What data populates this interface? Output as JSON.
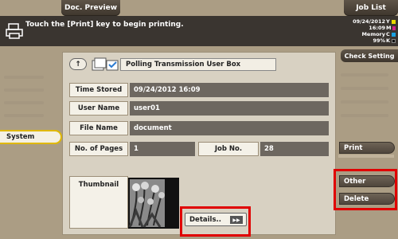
{
  "header": {
    "doc_preview_tab": "Doc. Preview",
    "job_list_tab": "Job List"
  },
  "message_bar": {
    "text": "Touch the [Print] key to begin printing.",
    "date": "09/24/2012",
    "time": "16:09",
    "memory_label": "Memory",
    "memory_value": "99%",
    "toner": [
      {
        "letter": "Y",
        "color": "#e8d800"
      },
      {
        "letter": "M",
        "color": "#d0208a"
      },
      {
        "letter": "C",
        "color": "#1aa0e0"
      },
      {
        "letter": "K",
        "color": "#111111"
      }
    ]
  },
  "left_nav": {
    "system_label": "System"
  },
  "panel": {
    "title": "Polling Transmission User Box",
    "back_icon": "up-arrow-icon",
    "fields": {
      "time_stored_label": "Time Stored",
      "time_stored_value": "09/24/2012 16:09",
      "user_name_label": "User Name",
      "user_name_value": "user01",
      "file_name_label": "File Name",
      "file_name_value": "document",
      "pages_label": "No. of Pages",
      "pages_value": "1",
      "job_no_label": "Job No.",
      "job_no_value": "28"
    },
    "thumbnail_label": "Thumbnail",
    "details_button": "Details.."
  },
  "right_nav": {
    "check_setting": "Check Setting",
    "print": "Print",
    "other": "Other",
    "delete": "Delete"
  },
  "colors": {
    "highlight": "#e00000",
    "system_border": "#e0b800"
  }
}
